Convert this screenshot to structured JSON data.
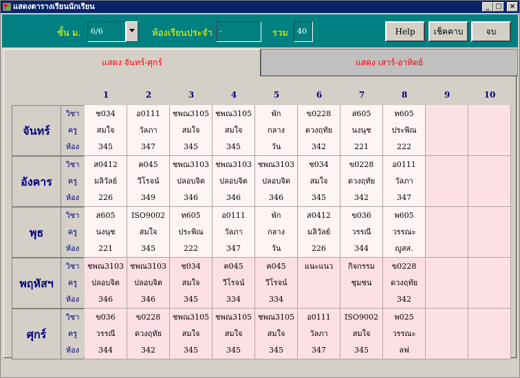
{
  "window": {
    "title": "แสดงตารางเรียนนักเรียน"
  },
  "toolbar": {
    "class_label": "ชั้น ม.",
    "class_value": "6/6",
    "homeroom_label": "ห้องเรียนประจำ",
    "homeroom_value": "-",
    "total_label": "รวม",
    "total_value": "40",
    "help_label": "Help",
    "check_label": "เช็คคาบ",
    "exit_label": "จบ"
  },
  "tabs": [
    {
      "label": "แสดง จันทร์-ศุกร์",
      "active": true
    },
    {
      "label": "แสดง เสาร์-อาทิตย์",
      "active": false
    }
  ],
  "row_labels": [
    "วิชา",
    "ครู",
    "ห้อง"
  ],
  "periods": [
    "1",
    "2",
    "3",
    "4",
    "5",
    "6",
    "7",
    "8",
    "9",
    "10"
  ],
  "days": [
    {
      "name": "จันทร์",
      "cells": [
        [
          "ช034",
          "สมใจ",
          "345"
        ],
        [
          "อ0111",
          "วัลภา",
          "347"
        ],
        [
          "ชพณ3105",
          "สมใจ",
          "345"
        ],
        [
          "ชพณ3105",
          "สมใจ",
          "345"
        ],
        [
          "พัก",
          "กลาง",
          "วัน"
        ],
        [
          "ข0228",
          "ดวงฤทัย",
          "342"
        ],
        [
          "ส605",
          "นงนุช",
          "221"
        ],
        [
          "ท605",
          "ประพิณ",
          "222"
        ],
        [
          "",
          "",
          ""
        ],
        [
          "",
          "",
          ""
        ]
      ]
    },
    {
      "name": "อังคาร",
      "cells": [
        [
          "ส0412",
          "มลิวัลย์",
          "226"
        ],
        [
          "ค045",
          "วีโรจน์",
          "349"
        ],
        [
          "ชพณ3103",
          "ปลอบจิต",
          "346"
        ],
        [
          "ชพณ3103",
          "ปลอบจิต",
          "346"
        ],
        [
          "ชพณ3103",
          "ปลอบจิต",
          "346"
        ],
        [
          "ช034",
          "สมใจ",
          "345"
        ],
        [
          "ข0228",
          "ดวงฤทัย",
          "342"
        ],
        [
          "อ0111",
          "วัลภา",
          "347"
        ],
        [
          "",
          "",
          ""
        ],
        [
          "",
          "",
          ""
        ]
      ]
    },
    {
      "name": "พุธ",
      "cells": [
        [
          "ส605",
          "นงนุช",
          "221"
        ],
        [
          "ISO9002",
          "สมใจ",
          "345"
        ],
        [
          "ท605",
          "ประพิณ",
          "222"
        ],
        [
          "อ0111",
          "วัลภา",
          "347"
        ],
        [
          "พัก",
          "กลาง",
          "วัน"
        ],
        [
          "ส0412",
          "มลิวัลย์",
          "226"
        ],
        [
          "ข036",
          "วรรณี",
          "344"
        ],
        [
          "พ605",
          "วรรณะ",
          "ญูสส."
        ],
        [
          "",
          "",
          ""
        ],
        [
          "",
          "",
          ""
        ]
      ]
    },
    {
      "name": "พฤหัสฯ",
      "cells": [
        [
          "ชพณ3103",
          "ปลอบจิต",
          "346"
        ],
        [
          "ชพณ3103",
          "ปลอบจิต",
          "346"
        ],
        [
          "ช034",
          "สมใจ",
          "345"
        ],
        [
          "ค045",
          "วีโรจน์",
          "334"
        ],
        [
          "ค045",
          "วีโรจน์",
          "334"
        ],
        [
          "แนะแนว",
          "",
          ""
        ],
        [
          "กิจกรรม",
          "ชุมชน",
          ""
        ],
        [
          "ข0228",
          "ดวงฤทัย",
          "342"
        ],
        [
          "",
          "",
          ""
        ],
        [
          "",
          "",
          ""
        ]
      ]
    },
    {
      "name": "ศุกร์",
      "cells": [
        [
          "ข036",
          "วรรณี",
          "344"
        ],
        [
          "ข0228",
          "ดวงฤทัย",
          "342"
        ],
        [
          "ชพณ3105",
          "สมใจ",
          "345"
        ],
        [
          "ชพณ3105",
          "สมใจ",
          "345"
        ],
        [
          "ชพณ3105",
          "สมใจ",
          "345"
        ],
        [
          "อ0111",
          "วัลภา",
          "347"
        ],
        [
          "ISO9002",
          "สมใจ",
          "345"
        ],
        [
          "พ025",
          "วรรณะ",
          "ลฟ"
        ],
        [
          "",
          "",
          ""
        ],
        [
          "",
          "",
          ""
        ]
      ]
    }
  ],
  "colors": {
    "title_bar": "#0a246a",
    "toolbar": "#008080",
    "label_yellow": "#ffff00",
    "tab_text": "#ff0000",
    "header_blue": "#000080"
  }
}
